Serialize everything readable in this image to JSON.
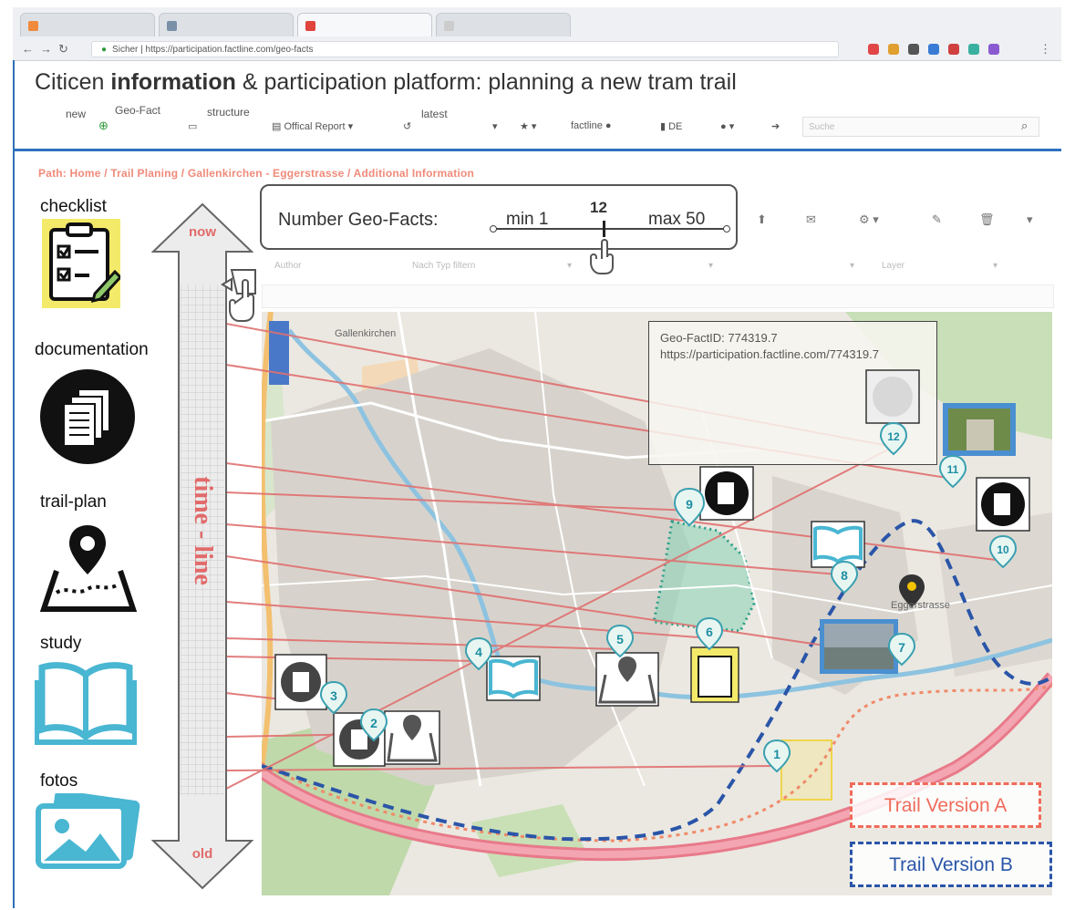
{
  "browser": {
    "tabs": [
      "",
      "",
      "",
      ""
    ],
    "url": "Sicher | https://participation.factline.com/geo-facts"
  },
  "page": {
    "title_part1": "Citicen ",
    "title_bold": "information",
    "title_part2": " & participation platform: planning a new tram trail"
  },
  "toolbar": {
    "new_label": "new",
    "geofact_label": "Geo-Fact",
    "structure_label": "structure",
    "latest_label": "latest",
    "report_label": "Offical Report",
    "factline_label": "factline",
    "lang_label": "DE",
    "search_placeholder": "Suche"
  },
  "breadcrumb": "Path: Home / Trail Planing / Gallenkirchen - Eggerstrasse / Additional Information",
  "legend": {
    "checklist": "checklist",
    "documentation": "documentation",
    "trail_plan": "trail-plan",
    "study": "study",
    "fotos": "fotos"
  },
  "timeline": {
    "top": "now",
    "bottom": "old",
    "label": "time - line"
  },
  "geofacts_panel": {
    "label": "Number Geo-Facts:",
    "min": "min 1",
    "max": "max 50",
    "value": "12"
  },
  "filters": {
    "author": "Author",
    "sort": "Nach Typ filtern",
    "layer": "Layer"
  },
  "tooltip": {
    "id": "Geo-FactID: 774319.7",
    "url": "https://participation.factline.com/774319.7"
  },
  "map_labels": {
    "town": "Gallenkirchen",
    "village": "Eggerstrasse"
  },
  "markers": [
    "1",
    "2",
    "3",
    "4",
    "5",
    "6",
    "7",
    "8",
    "9",
    "10",
    "11",
    "12"
  ],
  "trails": {
    "a": "Trail Version A",
    "b": "Trail Version B",
    "color_a": "#f06b5b",
    "color_b": "#2a55a8"
  },
  "colors": {
    "accent": "#2f72c0",
    "timeline_line": "#e07070",
    "marker": "#3aa0b0"
  }
}
